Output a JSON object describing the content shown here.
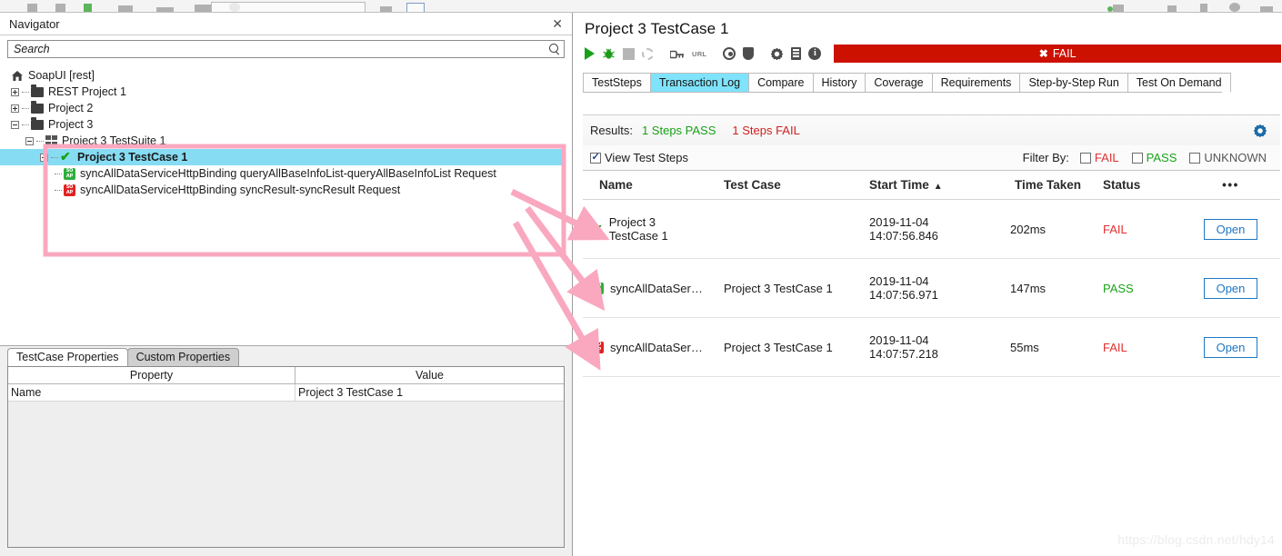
{
  "navigator": {
    "title": "Navigator",
    "close_icon": "close-icon",
    "search": {
      "placeholder": "Search",
      "value": "",
      "icon": "search-icon"
    },
    "tree": [
      {
        "label": "SoapUI [rest]",
        "icon": "home-icon",
        "indent": 1,
        "expander": "none",
        "selected": false
      },
      {
        "label": "REST Project 1",
        "icon": "folder-icon",
        "indent": 1,
        "expander": "plus",
        "selected": false
      },
      {
        "label": "Project 2",
        "icon": "folder-icon",
        "indent": 1,
        "expander": "plus",
        "selected": false
      },
      {
        "label": "Project 3",
        "icon": "folder-icon",
        "indent": 1,
        "expander": "minus",
        "selected": false
      },
      {
        "label": "Project 3 TestSuite 1",
        "icon": "testsuite-icon",
        "indent": 2,
        "expander": "minus",
        "selected": false
      },
      {
        "label": "Project 3 TestCase 1",
        "icon": "check-icon",
        "indent": 3,
        "expander": "minus",
        "selected": true
      },
      {
        "label": "syncAllDataServiceHttpBinding queryAllBaseInfoList-queryAllBaseInfoList Request",
        "icon": "soap-request-green-icon",
        "indent": 4,
        "expander": "none",
        "selected": false
      },
      {
        "label": "syncAllDataServiceHttpBinding syncResult-syncResult Request",
        "icon": "soap-request-red-icon",
        "indent": 4,
        "expander": "none",
        "selected": false
      }
    ]
  },
  "properties": {
    "tabs": [
      {
        "label": "TestCase Properties",
        "active": true
      },
      {
        "label": "Custom Properties",
        "active": false
      }
    ],
    "columns": [
      "Property",
      "Value"
    ],
    "rows": [
      {
        "property": "Name",
        "value": "Project 3 TestCase 1"
      }
    ]
  },
  "testcase": {
    "title": "Project 3 TestCase 1",
    "toolbar": [
      {
        "name": "run-icon",
        "label": "Run"
      },
      {
        "name": "debug-bug-icon",
        "label": "Debug"
      },
      {
        "name": "stop-icon",
        "label": "Stop"
      },
      {
        "name": "loop-icon",
        "label": "Loop"
      },
      {
        "name": "key-icon",
        "label": "Credentials"
      },
      {
        "name": "url-icon",
        "label": "URL"
      },
      {
        "name": "target-icon",
        "label": "Target"
      },
      {
        "name": "shield-icon",
        "label": "Security"
      },
      {
        "name": "options-gear-icon",
        "label": "Options"
      },
      {
        "name": "log-list-icon",
        "label": "Log"
      },
      {
        "name": "info-icon",
        "label": "Info"
      }
    ],
    "status_bar": {
      "text": "FAIL",
      "icon": "x-icon",
      "color": "#cc1100"
    },
    "tabs": [
      {
        "label": "TestSteps",
        "active": false
      },
      {
        "label": "Transaction Log",
        "active": true
      },
      {
        "label": "Compare",
        "active": false
      },
      {
        "label": "History",
        "active": false
      },
      {
        "label": "Coverage",
        "active": false
      },
      {
        "label": "Requirements",
        "active": false
      },
      {
        "label": "Step-by-Step Run",
        "active": false
      },
      {
        "label": "Test On Demand",
        "active": false
      }
    ]
  },
  "results": {
    "label": "Results:",
    "pass_text": "1 Steps PASS",
    "fail_text": "1 Steps FAIL",
    "gear_icon": "settings-gear-icon",
    "view_test_steps": {
      "label": "View Test Steps",
      "checked": true
    },
    "filter_label": "Filter By:",
    "filters": [
      {
        "label": "FAIL",
        "checked": false
      },
      {
        "label": "PASS",
        "checked": false
      },
      {
        "label": "UNKNOWN",
        "checked": false
      }
    ]
  },
  "table": {
    "columns": [
      "Name",
      "Test Case",
      "Start Time",
      "Time Taken",
      "Status",
      "•••"
    ],
    "sort_column": "Start Time",
    "sort_direction": "asc",
    "rows": [
      {
        "icon": "check-icon",
        "name": "Project 3\nTestCase 1",
        "test_case": "",
        "start_time": "2019-11-04\n14:07:56.846",
        "time_taken": "202ms",
        "status": "FAIL",
        "action": "Open"
      },
      {
        "icon": "soap-request-green-icon",
        "name": "syncAllDataSer…",
        "test_case": "Project 3 TestCase 1",
        "start_time": "2019-11-04\n14:07:56.971",
        "time_taken": "147ms",
        "status": "PASS",
        "action": "Open"
      },
      {
        "icon": "soap-request-red-icon",
        "name": "syncAllDataSer…",
        "test_case": "Project 3 TestCase 1",
        "start_time": "2019-11-04\n14:07:57.218",
        "time_taken": "55ms",
        "status": "FAIL",
        "action": "Open"
      }
    ]
  },
  "annotations": {
    "highlight_color": "#f9a8c0",
    "box_label": "",
    "arrow_count": 3
  },
  "watermark": "https://blog.csdn.net/hdy14",
  "colors": {
    "accent_blue": "#1f77c4",
    "fail_red": "#e03030",
    "pass_green": "#1aa31a",
    "status_bar_red": "#cc1100",
    "tab_active": "#7fe3fb",
    "tree_selected": "#86dcf3",
    "annotation_pink": "#f9a8c0"
  }
}
